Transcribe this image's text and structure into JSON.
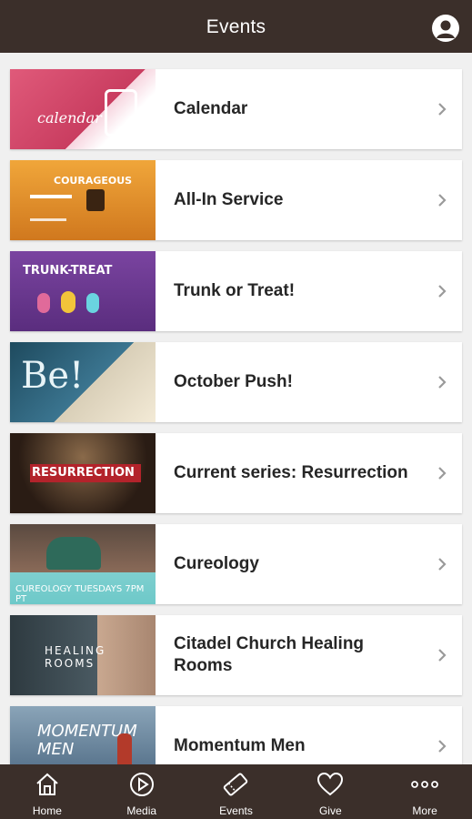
{
  "header": {
    "title": "Events"
  },
  "events": [
    {
      "label": "Calendar",
      "thumb_text": "calendar",
      "thumb_bg": "#d44a6a"
    },
    {
      "label": "All-In Service",
      "thumb_text": "COURAGEOUS",
      "thumb_bg": "#e0902a"
    },
    {
      "label": "Trunk or Treat!",
      "thumb_text": "TRUNK-TREAT",
      "thumb_bg": "#6a3a8c"
    },
    {
      "label": "October Push!",
      "thumb_text": "Be!",
      "thumb_bg": "#2d5a70"
    },
    {
      "label": "Current series: Resurrection",
      "thumb_text": "RESURRECTION",
      "thumb_bg": "#3a2a20"
    },
    {
      "label": "Cureology",
      "thumb_text": "CUREOLOGY TUESDAYS 7PM PT",
      "thumb_bg": "#6ec9c9"
    },
    {
      "label": "Citadel Church Healing Rooms",
      "thumb_text": "HEALING ROOMS",
      "thumb_bg": "#3b4a52"
    },
    {
      "label": "Momentum Men",
      "thumb_text": "MOMENTUM MEN",
      "thumb_bg": "#5a7892"
    }
  ],
  "tabbar": {
    "items": [
      {
        "label": "Home",
        "icon": "home-icon"
      },
      {
        "label": "Media",
        "icon": "play-icon"
      },
      {
        "label": "Events",
        "icon": "ticket-icon",
        "active": true
      },
      {
        "label": "Give",
        "icon": "heart-icon"
      },
      {
        "label": "More",
        "icon": "more-icon"
      }
    ]
  },
  "colors": {
    "bar": "#3b2f2a",
    "background": "#f0f0f0",
    "text": "#262626"
  }
}
